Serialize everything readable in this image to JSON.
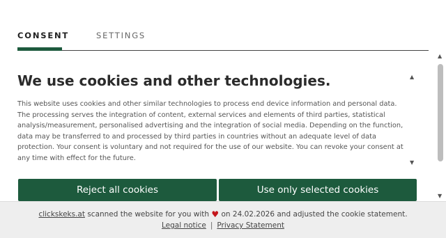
{
  "tabs": {
    "consent_label": "CONSENT",
    "settings_label": "SETTINGS"
  },
  "content": {
    "heading": "We use cookies and other technologies.",
    "body": "This website uses cookies and other similar technologies to process end device information and personal data. The processing serves the integration of content, external services and elements of third parties, statistical analysis/measurement, personalised advertising and the integration of social media. Depending on the function, data may be transferred to and processed by third parties in countries without an adequate level of data protection. Your consent is voluntary and not required for the use of our website. You can revoke your consent at any time with effect for the future."
  },
  "buttons": {
    "reject_label": "Reject all cookies",
    "selected_label": "Use only selected cookies"
  },
  "footer": {
    "brand_link": "clickskeks.at",
    "text_before_heart": " scanned the website for you with ",
    "heart_icon": "heart-icon",
    "text_after_heart": " on 24.02.2026 and adjusted the cookie statement.",
    "legal_notice": "Legal notice",
    "separator": "|",
    "privacy_statement": "Privacy Statement"
  },
  "icons": {
    "scroll_up": "▲",
    "scroll_down": "▼"
  },
  "colors": {
    "accent": "#1d5a3d",
    "heart": "#c4161c",
    "footer_bg": "#eeeeee"
  }
}
